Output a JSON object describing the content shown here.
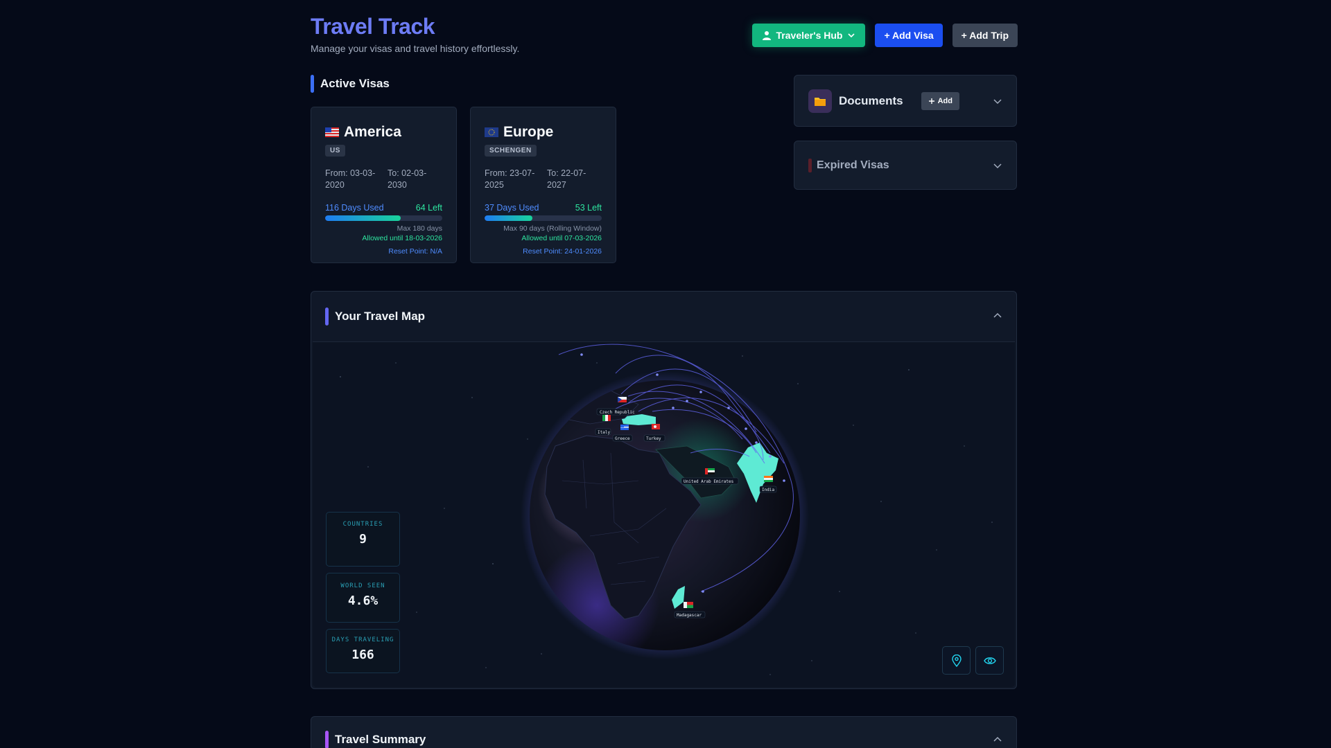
{
  "header": {
    "title": "Travel Track",
    "subtitle": "Manage your visas and travel history effortlessly.",
    "hub_label": "Traveler's Hub",
    "add_visa_label": "+ Add Visa",
    "add_trip_label": "+ Add Trip"
  },
  "active_visas": {
    "title": "Active Visas",
    "cards": [
      {
        "name": "America",
        "code": "US",
        "from": "From: 03-03-2020",
        "to": "To: 02-03-2030",
        "used": "116 Days Used",
        "left": "64 Left",
        "progress": 0.644,
        "max": "Max 180 days",
        "allowed": "Allowed until 18-03-2026",
        "reset": "Reset Point: N/A"
      },
      {
        "name": "Europe",
        "code": "SCHENGEN",
        "from": "From: 23-07-2025",
        "to": "To: 22-07-2027",
        "used": "37 Days Used",
        "left": "53 Left",
        "progress": 0.411,
        "max": "Max 90 days (Rolling Window)",
        "allowed": "Allowed until 07-03-2026",
        "reset": "Reset Point: 24-01-2026"
      }
    ]
  },
  "documents": {
    "title": "Documents",
    "add_label": "Add"
  },
  "expired": {
    "title": "Expired Visas"
  },
  "travel_map": {
    "title": "Your Travel Map",
    "stats": [
      {
        "label": "COUNTRIES",
        "value": "9"
      },
      {
        "label": "WORLD SEEN",
        "value": "4.6%"
      },
      {
        "label": "DAYS TRAVELING",
        "value": "166"
      }
    ],
    "countries": [
      "Czech Republic",
      "Italy",
      "Greece",
      "Turkey",
      "United Arab Emirates",
      "India",
      "Madagascar"
    ]
  },
  "summary": {
    "title": "Travel Summary"
  },
  "colors": {
    "accent_blue": "#4f8cff",
    "accent_green": "#12b77f",
    "map_accent": "#6366f1",
    "summary_accent": "#a855f7",
    "visited_fill": "#5eead4"
  }
}
